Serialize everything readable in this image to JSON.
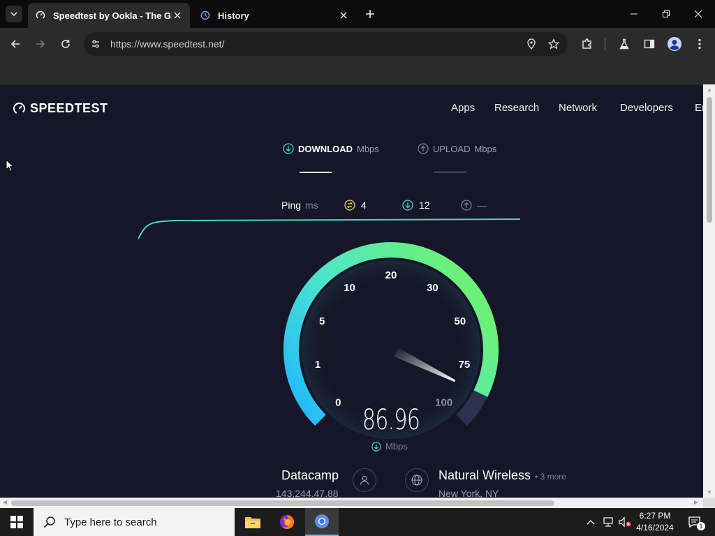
{
  "browser": {
    "tabs": [
      {
        "title": "Speedtest by Ookla - The Glob",
        "active": true
      },
      {
        "title": "History",
        "active": false
      }
    ],
    "url": "https://www.speedtest.net/"
  },
  "site": {
    "logo": "SPEEDTEST",
    "nav": [
      "Apps",
      "Research",
      "Network",
      "Developers",
      "En"
    ],
    "modes": [
      {
        "label": "DOWNLOAD",
        "unit": "Mbps",
        "active": true
      },
      {
        "label": "UPLOAD",
        "unit": "Mbps",
        "active": false
      }
    ],
    "ping": {
      "label": "Ping",
      "unit": "ms",
      "idle": "4",
      "download": "12",
      "upload": "—"
    },
    "gauge": {
      "ticks": [
        "0",
        "1",
        "5",
        "10",
        "20",
        "30",
        "50",
        "75",
        "100"
      ],
      "value_fraction": 0.93,
      "colors": {
        "start": "#1fb6ff",
        "end": "#6bf178",
        "track": "#2a3352"
      }
    },
    "speed": {
      "value": "86.96",
      "unit": "Mbps"
    },
    "isp": {
      "name": "Datacamp",
      "ip": "143.244.47.88"
    },
    "server": {
      "name": "Natural Wireless",
      "more": "• 3 more",
      "location": "New York, NY"
    }
  },
  "taskbar": {
    "search_placeholder": "Type here to search",
    "time": "6:27 PM",
    "date": "4/16/2024",
    "notification_count": "1"
  }
}
